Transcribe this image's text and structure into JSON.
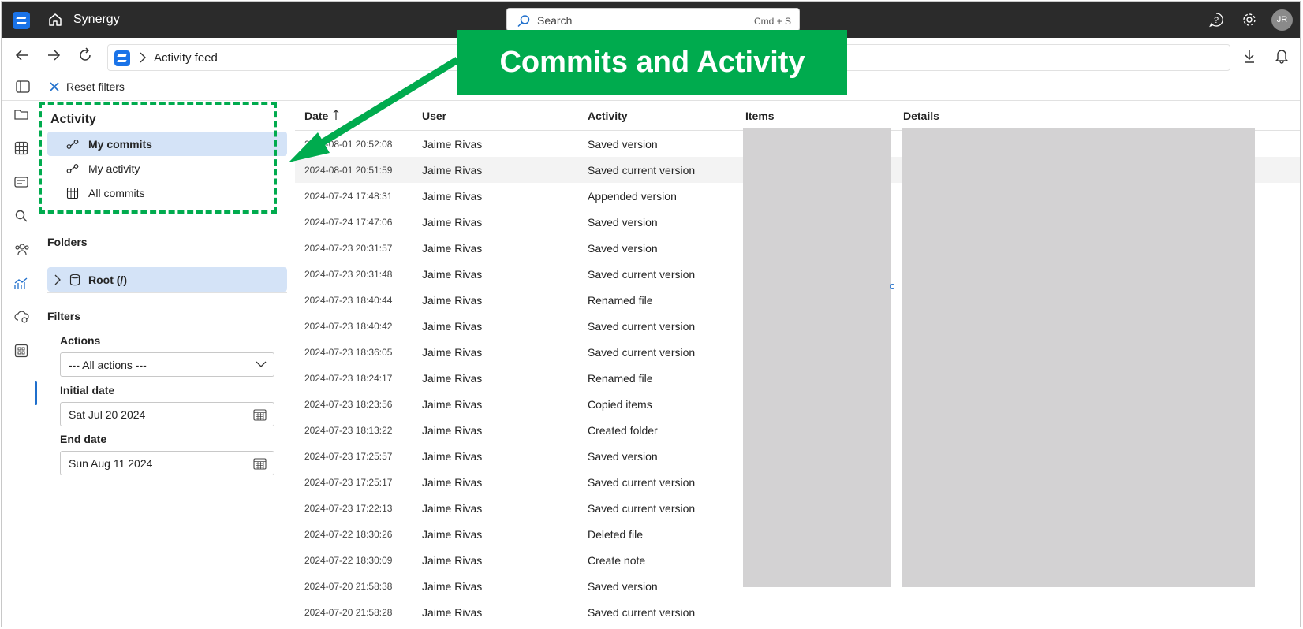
{
  "app": {
    "name": "Synergy",
    "avatar_initials": "JR"
  },
  "search": {
    "placeholder": "Search",
    "shortcut": "Cmd + S"
  },
  "address": {
    "breadcrumb": "Activity feed"
  },
  "toolbar": {
    "reset_filters": "Reset filters"
  },
  "sidebar": {
    "activity_title": "Activity",
    "items": [
      {
        "label": "My commits",
        "icon": "commit-icon",
        "selected": true
      },
      {
        "label": "My activity",
        "icon": "commit-icon",
        "selected": false
      },
      {
        "label": "All commits",
        "icon": "table-icon",
        "selected": false
      }
    ],
    "folders_title": "Folders",
    "folder": {
      "label": "Root (/)",
      "icon": "database-icon"
    },
    "filters_title": "Filters",
    "actions_label": "Actions",
    "actions_value": "--- All actions ---",
    "initial_date_label": "Initial date",
    "initial_date_value": "Sat Jul 20 2024",
    "end_date_label": "End date",
    "end_date_value": "Sun Aug 11 2024"
  },
  "annotation": {
    "callout": "Commits and Activity",
    "color": "#00ab4e"
  },
  "table": {
    "headers": {
      "date": "Date",
      "user": "User",
      "activity": "Activity",
      "items": "Items",
      "details": "Details"
    },
    "sort": "ascending",
    "stray_text": "c",
    "rows": [
      {
        "date": "2024-08-01 20:52:08",
        "user": "Jaime Rivas",
        "activity": "Saved version"
      },
      {
        "date": "2024-08-01 20:51:59",
        "user": "Jaime Rivas",
        "activity": "Saved current version"
      },
      {
        "date": "2024-07-24 17:48:31",
        "user": "Jaime Rivas",
        "activity": "Appended version"
      },
      {
        "date": "2024-07-24 17:47:06",
        "user": "Jaime Rivas",
        "activity": "Saved version"
      },
      {
        "date": "2024-07-23 20:31:57",
        "user": "Jaime Rivas",
        "activity": "Saved version"
      },
      {
        "date": "2024-07-23 20:31:48",
        "user": "Jaime Rivas",
        "activity": "Saved current version"
      },
      {
        "date": "2024-07-23 18:40:44",
        "user": "Jaime Rivas",
        "activity": "Renamed file"
      },
      {
        "date": "2024-07-23 18:40:42",
        "user": "Jaime Rivas",
        "activity": "Saved current version"
      },
      {
        "date": "2024-07-23 18:36:05",
        "user": "Jaime Rivas",
        "activity": "Saved current version"
      },
      {
        "date": "2024-07-23 18:24:17",
        "user": "Jaime Rivas",
        "activity": "Renamed file"
      },
      {
        "date": "2024-07-23 18:23:56",
        "user": "Jaime Rivas",
        "activity": "Copied items"
      },
      {
        "date": "2024-07-23 18:13:22",
        "user": "Jaime Rivas",
        "activity": "Created folder"
      },
      {
        "date": "2024-07-23 17:25:57",
        "user": "Jaime Rivas",
        "activity": "Saved version"
      },
      {
        "date": "2024-07-23 17:25:17",
        "user": "Jaime Rivas",
        "activity": "Saved current version"
      },
      {
        "date": "2024-07-23 17:22:13",
        "user": "Jaime Rivas",
        "activity": "Saved current version"
      },
      {
        "date": "2024-07-22 18:30:26",
        "user": "Jaime Rivas",
        "activity": "Deleted file"
      },
      {
        "date": "2024-07-22 18:30:09",
        "user": "Jaime Rivas",
        "activity": "Create note"
      },
      {
        "date": "2024-07-20 21:58:38",
        "user": "Jaime Rivas",
        "activity": "Saved version"
      },
      {
        "date": "2024-07-20 21:58:28",
        "user": "Jaime Rivas",
        "activity": "Saved current version"
      }
    ]
  }
}
